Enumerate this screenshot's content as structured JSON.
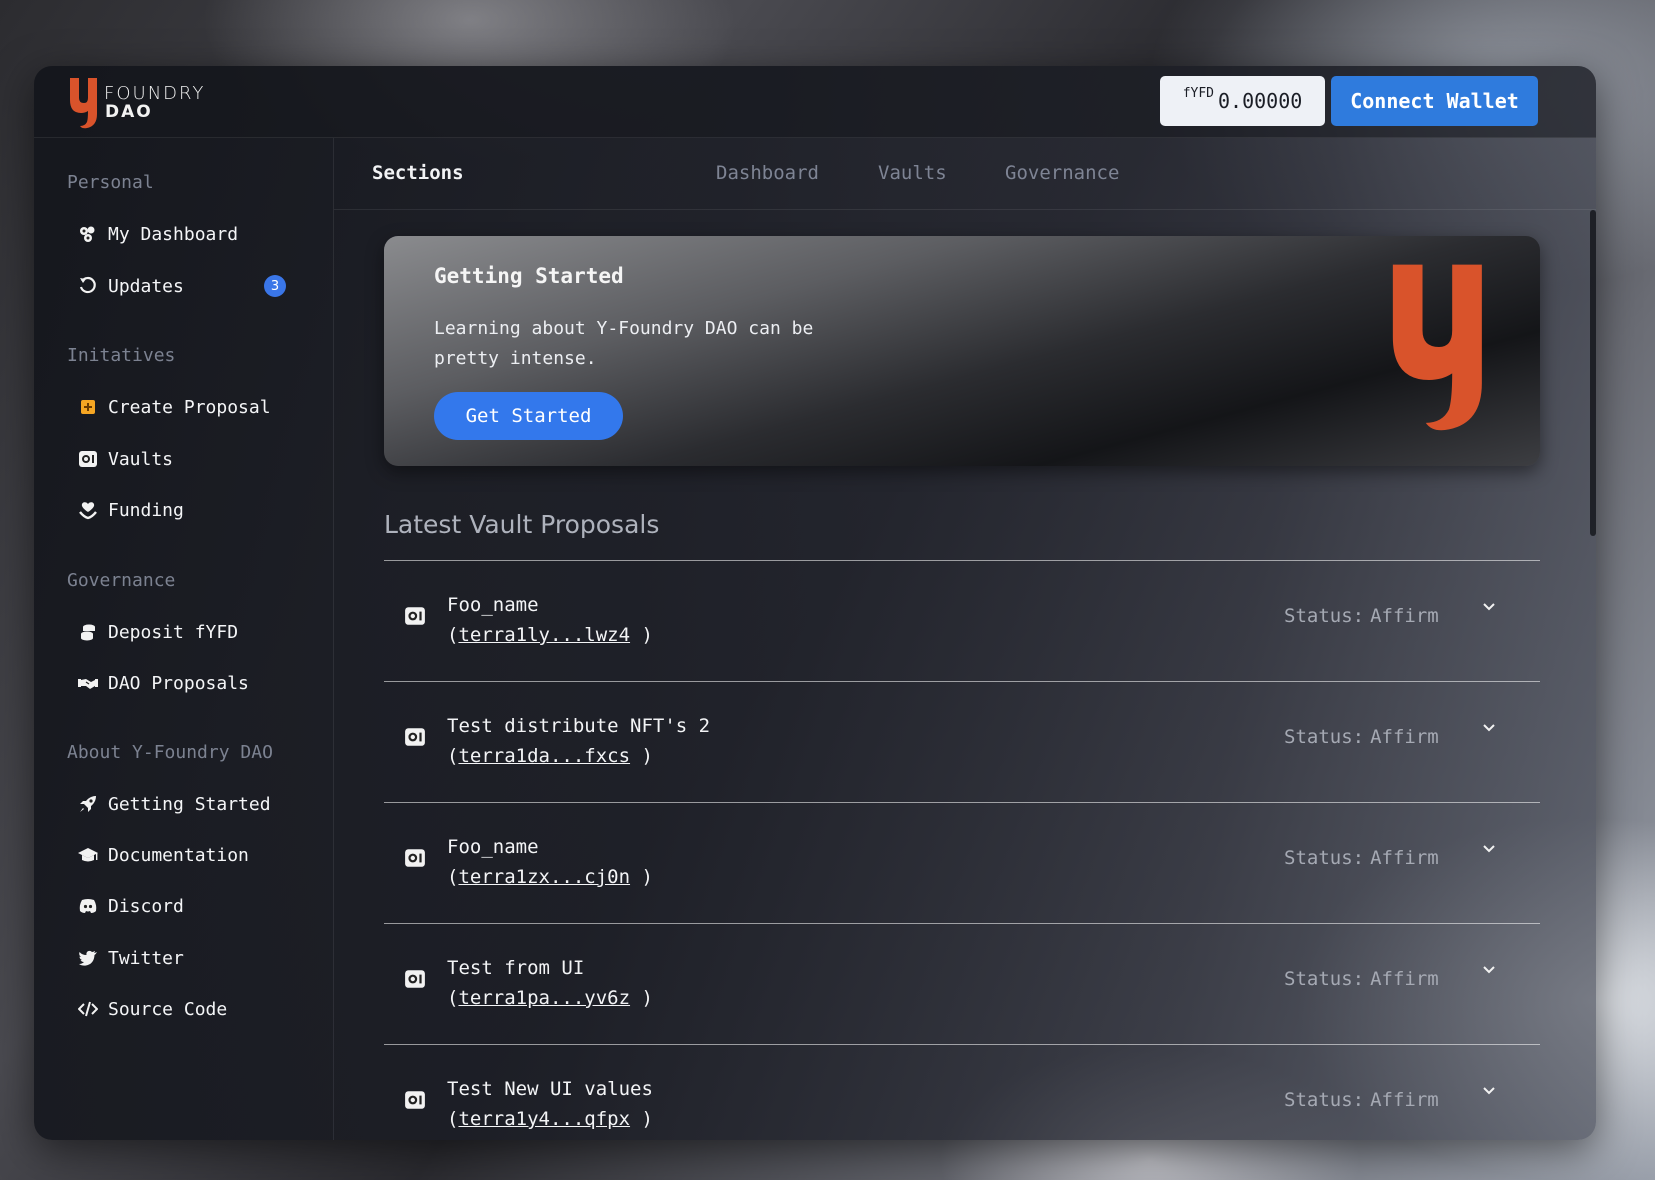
{
  "header": {
    "logo_line1": "FOUNDRY",
    "logo_line2": "DAO",
    "balance_unit": "fYFD",
    "balance_amount": "0.00000",
    "connect_label": "Connect Wallet"
  },
  "sidebar": {
    "groups": [
      {
        "title": "Personal"
      },
      {
        "title": "Initatives"
      },
      {
        "title": "Governance"
      },
      {
        "title": "About Y-Foundry DAO"
      }
    ],
    "items": [
      {
        "label": "My Dashboard",
        "icon": "dashboard-icon"
      },
      {
        "label": "Updates",
        "icon": "history-icon",
        "badge": "3"
      },
      {
        "label": "Create Proposal",
        "icon": "plus-square-icon"
      },
      {
        "label": "Vaults",
        "icon": "vault-icon"
      },
      {
        "label": "Funding",
        "icon": "hand-holding-heart-icon"
      },
      {
        "label": "Deposit fYFD",
        "icon": "coins-icon"
      },
      {
        "label": "DAO Proposals",
        "icon": "handshake-icon"
      },
      {
        "label": "Getting Started",
        "icon": "rocket-icon"
      },
      {
        "label": "Documentation",
        "icon": "graduation-cap-icon"
      },
      {
        "label": "Discord",
        "icon": "discord-icon"
      },
      {
        "label": "Twitter",
        "icon": "twitter-icon"
      },
      {
        "label": "Source Code",
        "icon": "code-icon"
      }
    ]
  },
  "sections": {
    "title": "Sections",
    "tabs": [
      {
        "label": "Dashboard"
      },
      {
        "label": "Vaults"
      },
      {
        "label": "Governance"
      }
    ]
  },
  "hero": {
    "title": "Getting Started",
    "text": "Learning about Y-Foundry DAO can be pretty intense.",
    "button": "Get Started"
  },
  "proposals": {
    "heading": "Latest Vault Proposals",
    "status_label": "Status:",
    "rows": [
      {
        "name": "Foo_name",
        "address": "terra1ly...lwz4",
        "status": "Affirm"
      },
      {
        "name": "Test distribute NFT's 2",
        "address": "terra1da...fxcs",
        "status": "Affirm"
      },
      {
        "name": "Foo_name",
        "address": "terra1zx...cj0n",
        "status": "Affirm"
      },
      {
        "name": "Test from UI",
        "address": "terra1pa...yv6z",
        "status": "Affirm"
      },
      {
        "name": "Test New UI values",
        "address": "terra1y4...qfpx",
        "status": "Affirm"
      }
    ]
  },
  "colors": {
    "accent": "#2f7bdd",
    "brand_orange": "#d9532b",
    "badge": "#3a76e8"
  }
}
